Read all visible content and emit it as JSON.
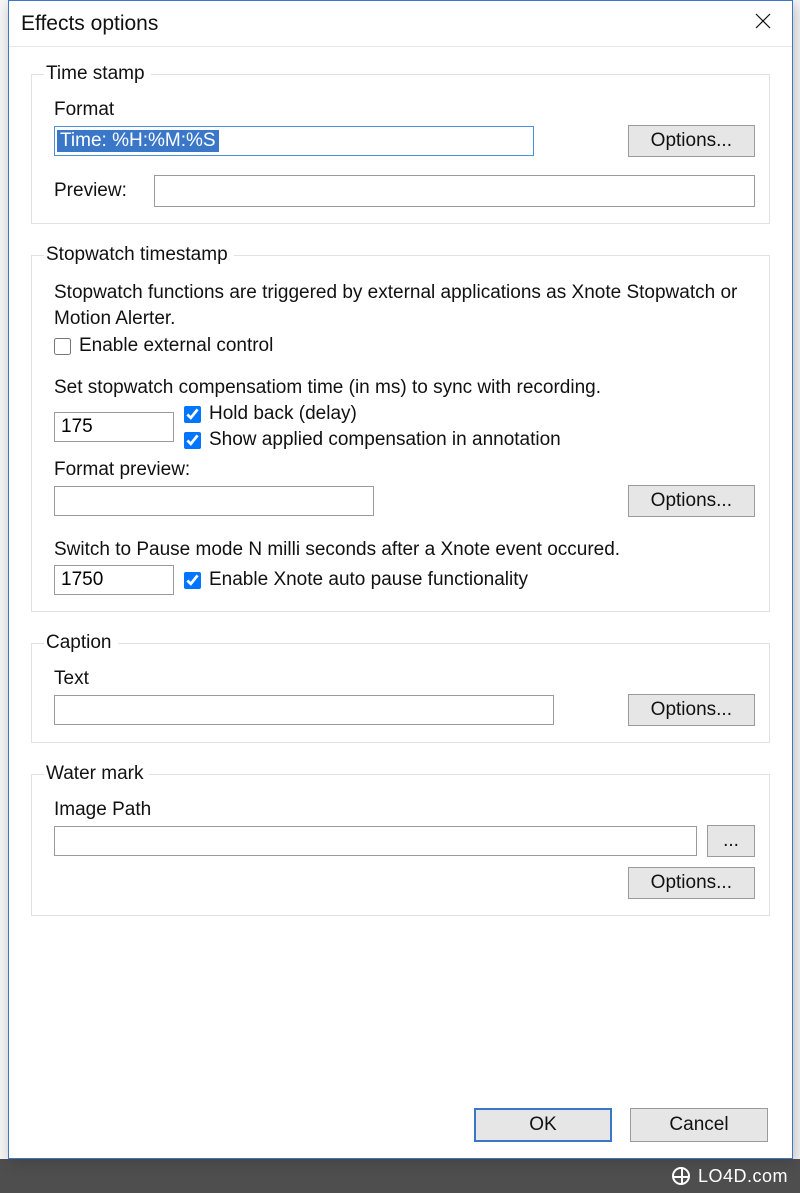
{
  "window": {
    "title": "Effects options"
  },
  "groups": {
    "timestamp": {
      "legend": "Time stamp",
      "format_label": "Format",
      "format_value": "Time: %H:%M:%S",
      "options_btn": "Options...",
      "preview_label": "Preview:",
      "preview_value": ""
    },
    "stopwatch": {
      "legend": "Stopwatch timestamp",
      "description": "Stopwatch functions are triggered by external applications as Xnote Stopwatch or Motion Alerter.",
      "enable_external_label": "Enable external control",
      "enable_external_checked": false,
      "compensation_label": "Set stopwatch compensatiom time (in ms) to sync with recording.",
      "compensation_value": "175",
      "holdback_label": "Hold back (delay)",
      "holdback_checked": true,
      "show_comp_label": "Show applied compensation in annotation",
      "show_comp_checked": true,
      "format_preview_label": "Format preview:",
      "format_preview_value": "",
      "options_btn": "Options...",
      "pause_desc": "Switch to Pause mode N milli seconds after a Xnote event occured.",
      "pause_value": "1750",
      "pause_enable_label": "Enable Xnote auto pause functionality",
      "pause_enable_checked": true
    },
    "caption": {
      "legend": "Caption",
      "text_label": "Text",
      "text_value": "",
      "options_btn": "Options..."
    },
    "watermark": {
      "legend": "Water mark",
      "path_label": "Image Path",
      "path_value": "",
      "browse_btn": "...",
      "options_btn": "Options..."
    }
  },
  "dialog_buttons": {
    "ok": "OK",
    "cancel": "Cancel"
  },
  "footer": {
    "text": "LO4D.com"
  }
}
